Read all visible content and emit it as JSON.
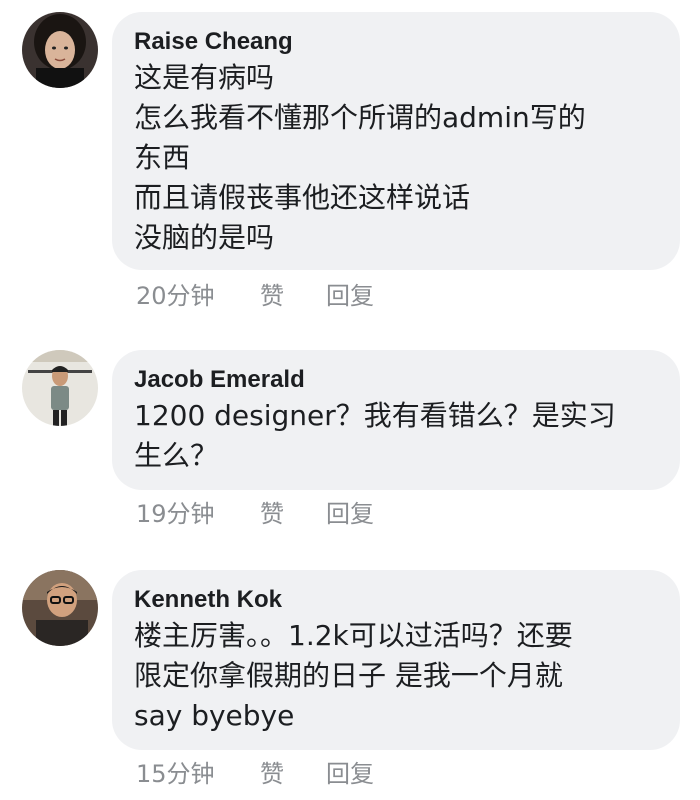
{
  "comments": [
    {
      "author": "Raise Cheang",
      "lines": [
        "这是有病吗",
        "怎么我看不懂那个所谓的admin写的",
        "东西",
        "而且请假丧事他还这样说话",
        "没脑的是吗"
      ],
      "time": "20分钟",
      "like": "赞",
      "reply": "回复"
    },
    {
      "author": "Jacob Emerald",
      "lines": [
        "1200 designer？我有看错么？是实习",
        "生么？"
      ],
      "time": "19分钟",
      "like": "赞",
      "reply": "回复"
    },
    {
      "author": "Kenneth Kok",
      "lines": [
        "楼主厉害。。1.2k可以过活吗？还要",
        "限定你拿假期的日子 是我一个月就",
        "say byebye"
      ],
      "time": "15分钟",
      "like": "赞",
      "reply": "回复"
    }
  ],
  "colors": {
    "bubble": "#f0f1f3",
    "name": "#1c1e21",
    "meta": "#8a8d91"
  },
  "icons": [
    "avatar-raise-cheang",
    "avatar-jacob-emerald",
    "avatar-kenneth-kok"
  ]
}
